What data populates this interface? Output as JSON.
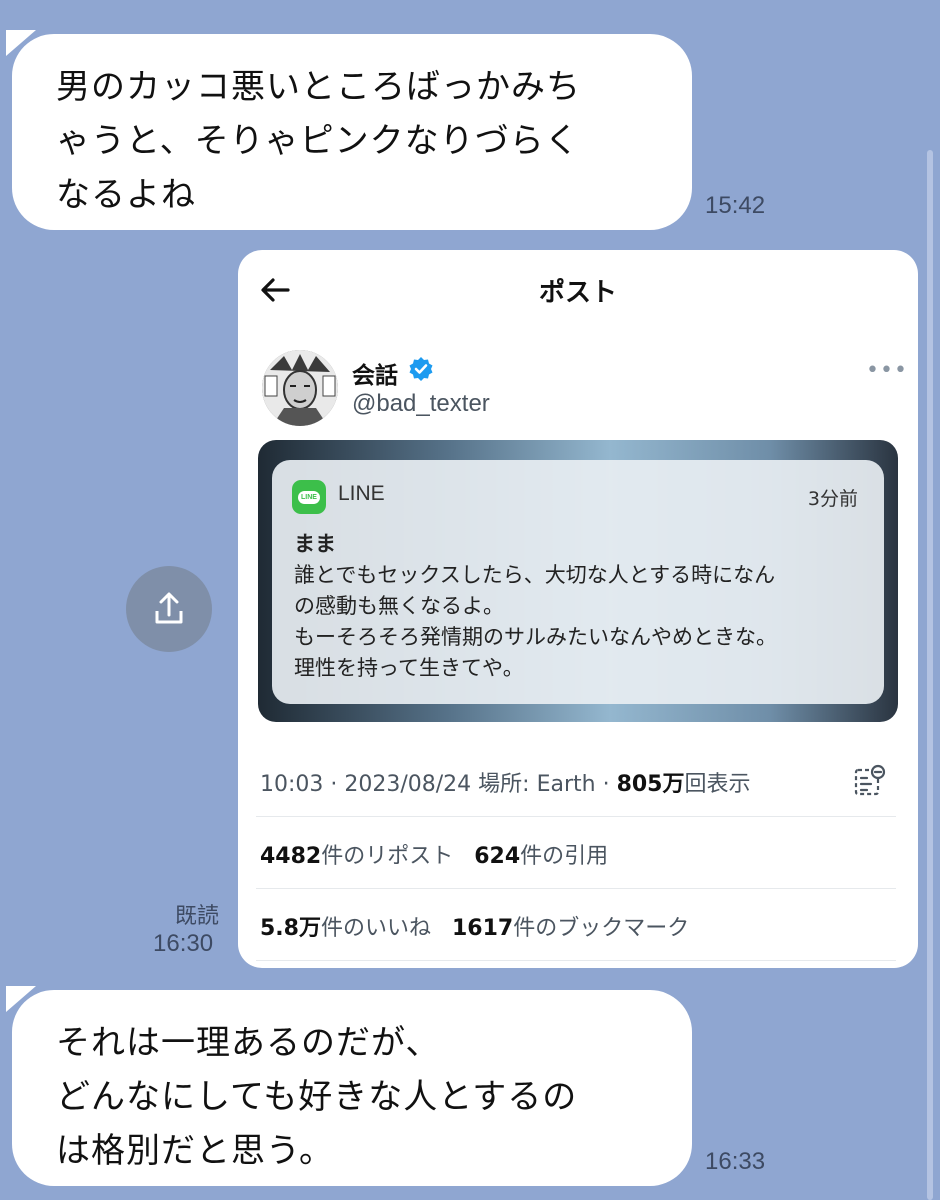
{
  "messages": [
    {
      "lines": [
        "男のカッコ悪いところばっかみち",
        "ゃうと、そりゃピンクなりづらく",
        "なるよね"
      ],
      "time": "15:42"
    },
    {
      "lines": [
        "それは一理あるのだが、",
        "どんなにしても好きな人とするの",
        "は格別だと思う。"
      ],
      "time": "16:33"
    }
  ],
  "sent": {
    "read_label": "既読",
    "time": "16:30"
  },
  "post": {
    "title": "ポスト",
    "user_name": "会話",
    "user_handle": "@bad_texter",
    "notification": {
      "app": "LINE",
      "logo_text": "LINE",
      "time_ago": "3分前",
      "sender": "まま",
      "body_lines": [
        "誰とでもセックスしたら、大切な人とする時になん",
        "の感動も無くなるよ。",
        "もーそろそろ発情期のサルみたいなんやめときな。",
        "理性を持って生きてや。"
      ]
    },
    "meta": {
      "datetime": "10:03 · 2023/08/24 場所: Earth · ",
      "views": "805万",
      "views_suffix": "回表示"
    },
    "stats": {
      "reposts": "4482",
      "reposts_label": "件のリポスト",
      "quotes": "624",
      "quotes_label": "件の引用",
      "likes": "5.8万",
      "likes_label": "件のいいね",
      "bookmarks": "1617",
      "bookmarks_label": "件のブックマーク"
    }
  },
  "icons": {
    "share": "share-icon",
    "back": "back-arrow-icon",
    "verified": "verified-badge-icon",
    "more": "more-options-icon",
    "analytics": "analytics-icon"
  },
  "colors": {
    "background": "#8fa6d1",
    "bubble": "#ffffff",
    "verified": "#1d9bf0",
    "line_green": "#3cbf4a"
  }
}
